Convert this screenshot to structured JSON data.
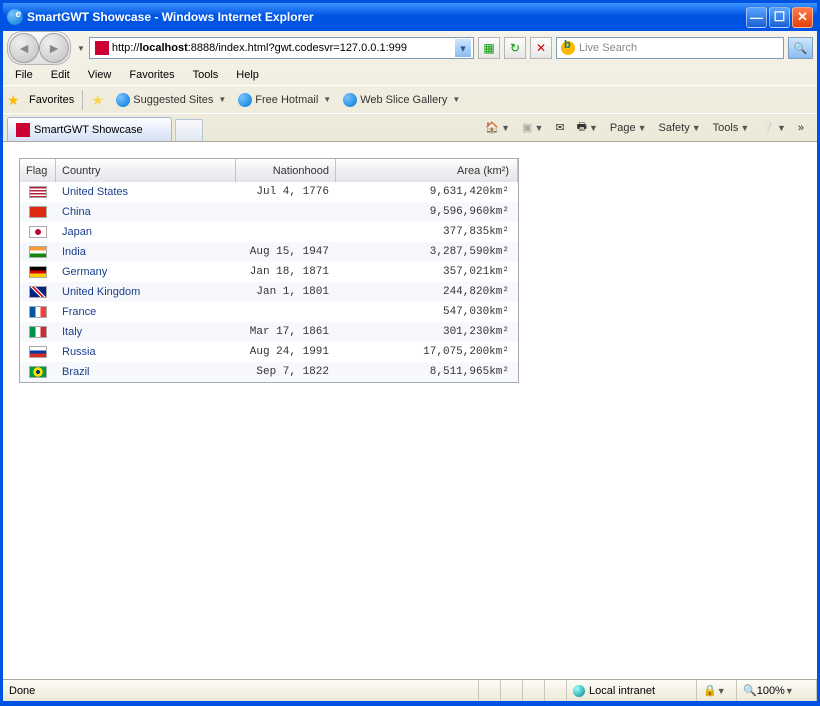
{
  "window": {
    "title": "SmartGWT Showcase - Windows Internet Explorer"
  },
  "nav": {
    "back": "◄",
    "forward": "►"
  },
  "url": {
    "prefix": "http://",
    "host": "localhost",
    "rest": ":8888/index.html?gwt.codesvr=127.0.0.1:999"
  },
  "navglyphs": {
    "refresh": "↻",
    "stop": "✕"
  },
  "search": {
    "placeholder": "Live Search",
    "go": "🔍"
  },
  "menus": {
    "file": "File",
    "edit": "Edit",
    "view": "View",
    "favorites": "Favorites",
    "tools": "Tools",
    "help": "Help"
  },
  "favorites": {
    "label": "Favorites",
    "suggested": "Suggested Sites",
    "hotmail": "Free Hotmail",
    "webslice": "Web Slice Gallery"
  },
  "tab": {
    "label": "SmartGWT Showcase"
  },
  "cmdbar": {
    "page": "Page",
    "safety": "Safety",
    "tools": "Tools",
    "chev": "»"
  },
  "grid": {
    "headers": {
      "flag": "Flag",
      "country": "Country",
      "nationhood": "Nationhood",
      "area": "Area (km²)"
    },
    "rows": [
      {
        "flag": "us",
        "country": "United States",
        "nationhood": "Jul 4, 1776",
        "area": "9,631,420km²"
      },
      {
        "flag": "cn",
        "country": "China",
        "nationhood": "",
        "area": "9,596,960km²"
      },
      {
        "flag": "jp",
        "country": "Japan",
        "nationhood": "",
        "area": "377,835km²"
      },
      {
        "flag": "in",
        "country": "India",
        "nationhood": "Aug 15, 1947",
        "area": "3,287,590km²"
      },
      {
        "flag": "de",
        "country": "Germany",
        "nationhood": "Jan 18, 1871",
        "area": "357,021km²"
      },
      {
        "flag": "gb",
        "country": "United Kingdom",
        "nationhood": "Jan 1, 1801",
        "area": "244,820km²"
      },
      {
        "flag": "fr",
        "country": "France",
        "nationhood": "",
        "area": "547,030km²"
      },
      {
        "flag": "it",
        "country": "Italy",
        "nationhood": "Mar 17, 1861",
        "area": "301,230km²"
      },
      {
        "flag": "ru",
        "country": "Russia",
        "nationhood": "Aug 24, 1991",
        "area": "17,075,200km²"
      },
      {
        "flag": "br",
        "country": "Brazil",
        "nationhood": "Sep 7, 1822",
        "area": "8,511,965km²"
      }
    ]
  },
  "status": {
    "done": "Done",
    "zone": "Local intranet",
    "zoom": "100%"
  },
  "flagColors": {
    "us": "linear-gradient(to bottom, #b22234 0 15%, #fff 15% 30%, #b22234 30% 45%, #fff 45% 60%, #b22234 60% 75%, #fff 75% 90%, #b22234 90% 100%)",
    "cn": "#de2910",
    "jp": "radial-gradient(circle at 50% 50%, #bc002d 0 30%, #fff 31% 100%)",
    "in": "linear-gradient(to bottom, #ff9933 0 33%, #fff 33% 67%, #138808 67% 100%)",
    "de": "linear-gradient(to bottom, #000 0 33%, #dd0000 33% 67%, #ffce00 67% 100%)",
    "gb": "linear-gradient(45deg,#00247d 40%,#fff 40% 45%,#cf142b 45% 55%,#fff 55% 60%,#00247d 60%)",
    "fr": "linear-gradient(to right, #0055a4 0 33%, #fff 33% 67%, #ef4135 67% 100%)",
    "it": "linear-gradient(to right, #009246 0 33%, #fff 33% 67%, #ce2b37 67% 100%)",
    "ru": "linear-gradient(to bottom, #fff 0 33%, #0039a6 33% 67%, #d52b1e 67% 100%)",
    "br": "radial-gradient(circle at 50% 50%, #002776 0 20%, #fedf00 21% 50%, #009b3a 51% 100%)"
  }
}
